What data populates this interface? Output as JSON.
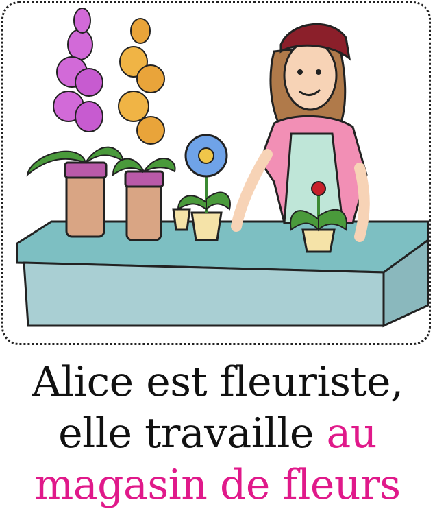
{
  "caption": {
    "line1": "Alice est fleuriste,",
    "line2_plain": "elle travaille ",
    "line2_accent": "au",
    "line3_accent": "magasin de fleurs"
  },
  "colors": {
    "accent": "#e0198a",
    "text": "#111111",
    "counter": "#7dbfc2",
    "apron": "#bfe6d8",
    "shirt": "#f28fb5",
    "scarf": "#8b1f2a"
  },
  "illustration": {
    "icons": [
      "florist-woman-illustration",
      "flower-pot-icon",
      "counter-illustration"
    ]
  }
}
